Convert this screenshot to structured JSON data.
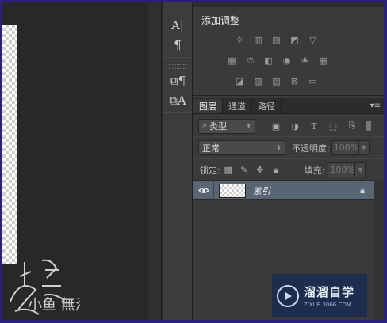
{
  "panels": {
    "adjustments_title": "添加调整",
    "tabs": [
      "图层",
      "通道",
      "路径"
    ]
  },
  "layers": {
    "filter_type": "类型",
    "blend_mode": "正常",
    "opacity_label": "不透明度:",
    "opacity_value": "100%",
    "lock_label": "锁定:",
    "fill_label": "填充:",
    "fill_value": "100%",
    "layer_name": "索引"
  },
  "watermark": {
    "left_text": "小鱼 無海",
    "brand": "溜溜自学",
    "url": "ZIXUE.3066.COM"
  },
  "colors": {
    "frame": "#2a1f7a",
    "panel": "#3a3a3a",
    "selected_layer": "#576575"
  }
}
